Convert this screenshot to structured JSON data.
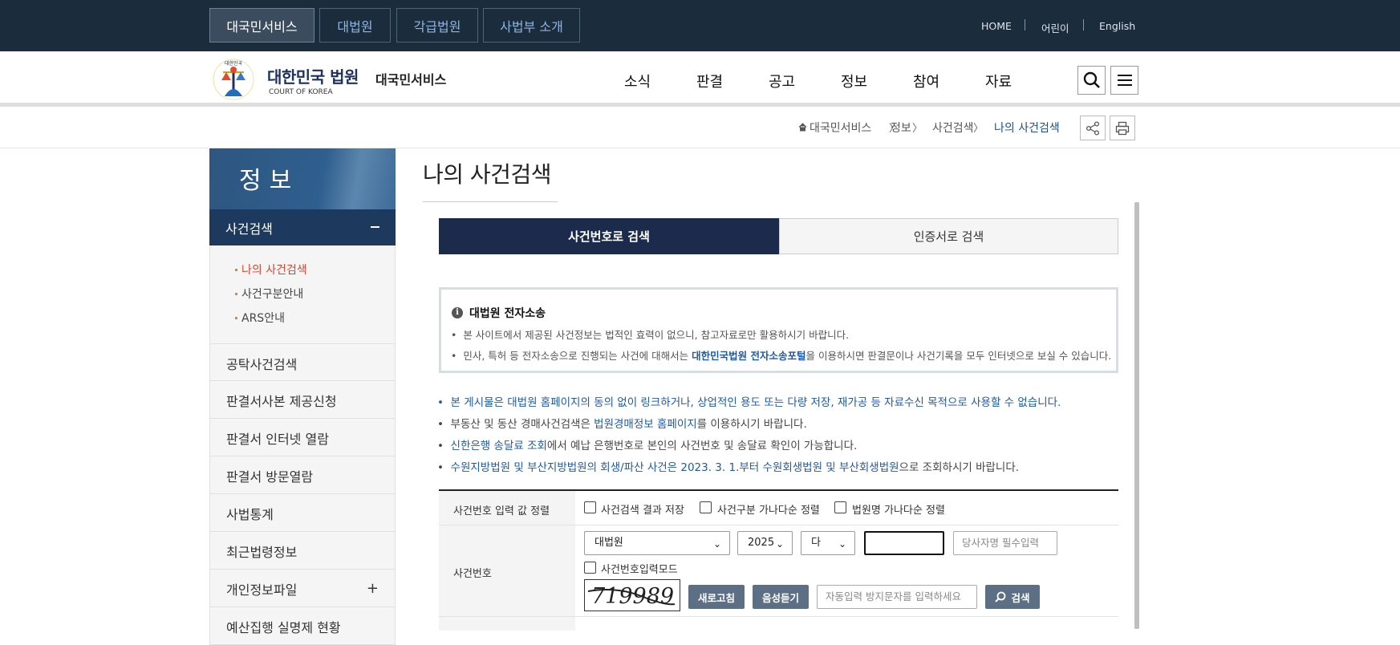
{
  "top_tabs": [
    "대국민서비스",
    "대법원",
    "각급법원",
    "사법부 소개"
  ],
  "top_links": [
    "HOME",
    "어린이",
    "English"
  ],
  "logo": {
    "title": "대한민국 법원",
    "en": "COURT OF KOREA",
    "sub": "대국민서비스"
  },
  "gnb": [
    "소식",
    "판결",
    "공고",
    "정보",
    "참여",
    "자료"
  ],
  "breadcrumb": {
    "home": "대국민서비스",
    "items": [
      "정보",
      "사건검색",
      "나의 사건검색"
    ],
    "sep": "〉"
  },
  "lnb": {
    "title": "정보",
    "active": "사건검색",
    "sub_items": [
      "나의 사건검색",
      "사건구분안내",
      "ARS안내"
    ],
    "items": [
      "공탁사건검색",
      "판결서사본 제공신청",
      "판결서 인터넷 열람",
      "판결서 방문열람",
      "사법통계",
      "최근법령정보",
      "개인정보파일",
      "예산집행 실명제 현황"
    ]
  },
  "main": {
    "title": "나의 사건검색",
    "tabs": [
      "사건번호로 검색",
      "인증서로 검색"
    ],
    "notice": {
      "title": "대법원 전자소송",
      "line1": "본 사이트에서 제공된 사건정보는 법적인 효력이 없으니, 참고자료로만 활용하시기 바랍니다.",
      "line2_a": "민사, 특허 등 전자소송으로 진행되는 사건에 대해서는 ",
      "line2_link": "대한민국법원 전자소송포털",
      "line2_b": "을 이용하시면 판결문이나 사건기록을 모두 인터넷으로 보실 수 있습니다."
    },
    "info": {
      "l1": "본 게시물은 대법원 홈페이지의 동의 없이 링크하거나, 상업적인 용도 또는 다량 저장, 재가공 등 자료수신 목적으로 사용할 수 없습니다.",
      "l2_a": "부동산 및 동산 경매사건검색은 ",
      "l2_link": "법원경매정보 홈페이지",
      "l2_b": "를 이용하시기 바랍니다.",
      "l3_link": "신한은행 송달료 조회",
      "l3_b": "에서 예납 은행번호로 본인의 사건번호 및 송달료 확인이 가능합니다.",
      "l4_a": "수원지방법원 및 부산지방법원의 회생/파산 사건은 2023. 3. 1.부터 수원회생법원 및 부산회생법원",
      "l4_b": "으로 조회하시기 바랍니다."
    },
    "form": {
      "row1_label": "사건번호 입력 값 정렬",
      "options": [
        "사건검색 결과 저장",
        "사건구분 가나다순 정렬",
        "법원명 가나다순 정렬"
      ],
      "row2_label": "사건번호",
      "court": "대법원",
      "year": "2025",
      "case_type": "다",
      "case_number": "",
      "party_placeholder": "당사자명 필수입력",
      "mode_label": "사건번호입력모드",
      "captcha_text": "719989",
      "refresh_label": "새로고침",
      "audio_label": "음성듣기",
      "captcha_placeholder": "자동입력 방지문자를 입력하세요",
      "search_label": "검색"
    }
  }
}
